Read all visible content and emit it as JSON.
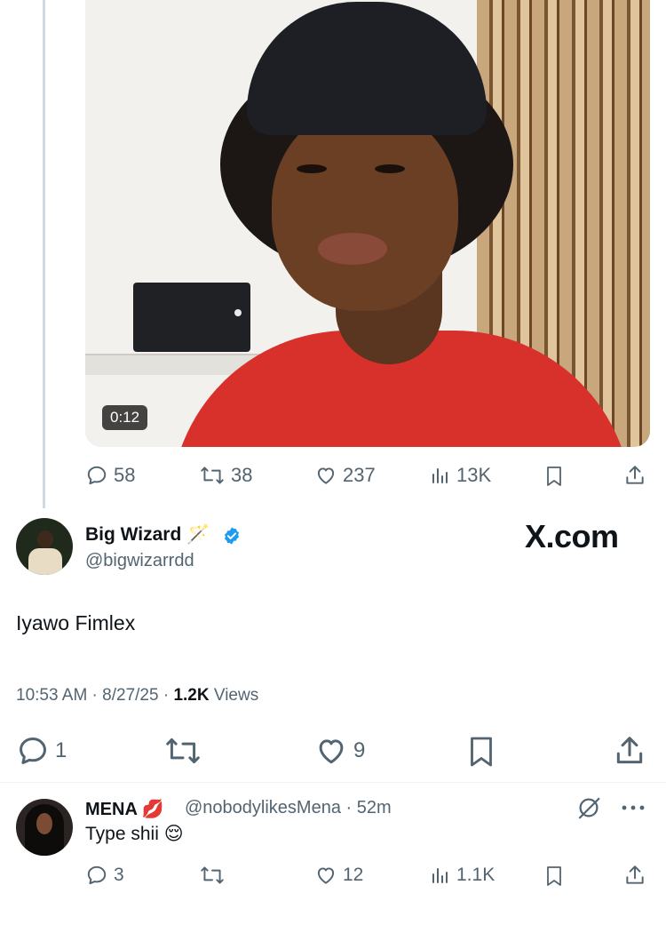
{
  "video": {
    "duration": "0:12"
  },
  "top_tweet_actions": {
    "replies": "58",
    "reposts": "38",
    "likes": "237",
    "views": "13K"
  },
  "main_tweet": {
    "author_name": "Big Wizard 🪄",
    "author_handle": "@bigwizarrdd",
    "watermark": "X.com",
    "text": "Iyawo Fimlex",
    "time": "10:53 AM · 8/27/25 · ",
    "views_count": "1.2K",
    "views_label": " Views",
    "replies": "1",
    "likes": "9"
  },
  "reply_tweet": {
    "author_name": "MENA 💋",
    "author_handle": "@nobodylikesMena · 52m",
    "text": "Type shii 😌",
    "replies": "3",
    "likes": "12",
    "views": "1.1K"
  },
  "colors": {
    "gray": "#536471",
    "verified_blue": "#1d9bf0",
    "text": "#0f1419"
  },
  "icons": [
    "reply-icon",
    "repost-icon",
    "like-icon",
    "views-icon",
    "bookmark-icon",
    "share-icon",
    "verified-icon",
    "grok-icon",
    "more-icon"
  ]
}
